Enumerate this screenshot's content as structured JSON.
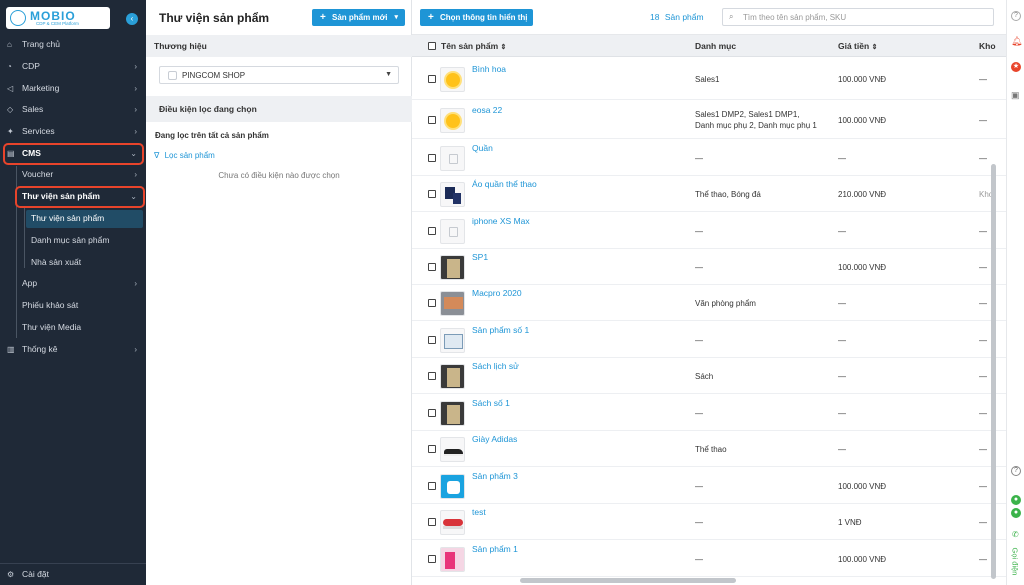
{
  "brand": {
    "name": "MOBIO",
    "tagline": "CDP & CEM Platform",
    "collapse_icon": "chevron-left-icon"
  },
  "sidebar": {
    "items": [
      {
        "label": "Trang chủ",
        "icon": "home-icon",
        "has_chevron": false
      },
      {
        "label": "CDP",
        "icon": "user-icon",
        "has_chevron": true
      },
      {
        "label": "Marketing",
        "icon": "megaphone-icon",
        "has_chevron": true
      },
      {
        "label": "Sales",
        "icon": "tag-icon",
        "has_chevron": true
      },
      {
        "label": "Services",
        "icon": "services-icon",
        "has_chevron": true
      },
      {
        "label": "CMS",
        "icon": "cms-icon",
        "has_chevron": true
      }
    ],
    "cms_children": [
      {
        "label": "Voucher",
        "has_chevron": true
      },
      {
        "label": "Thư viện sản phẩm",
        "has_chevron": true
      }
    ],
    "product_children": [
      {
        "label": "Thư viện sản phẩm"
      },
      {
        "label": "Danh mục sản phẩm"
      },
      {
        "label": "Nhà sản xuất"
      }
    ],
    "more_children": [
      {
        "label": "App",
        "has_chevron": true
      },
      {
        "label": "Phiếu khảo sát",
        "has_chevron": false
      },
      {
        "label": "Thư viện Media",
        "has_chevron": false
      }
    ],
    "stats": {
      "label": "Thống kê",
      "icon": "chart-icon"
    },
    "settings": {
      "label": "Cài đặt",
      "icon": "gear-icon"
    }
  },
  "header": {
    "title": "Thư viện sản phẩm",
    "new_product_label": "Sản phẩm mới",
    "choose_info_label": "Chọn thông tin hiển thị",
    "count_number": "18",
    "count_label": "Sản phẩm",
    "search_placeholder": "Tìm theo tên sản phẩm, SKU"
  },
  "filter_panel": {
    "brand_heading": "Thương hiệu",
    "brand_value": "PINGCOM SHOP",
    "conditions_heading": "Điều kiện lọc đang chọn",
    "filtering_text": "Đang lọc trên tất cả sản phẩm",
    "filter_link": "Lọc sản phẩm",
    "empty_text": "Chưa có điều kiện nào được chọn"
  },
  "table": {
    "columns": [
      "Tên sản phẩm",
      "Danh mục",
      "Giá tiền",
      "Kho"
    ],
    "rows": [
      {
        "name": "Bình hoa",
        "category": "Sales1",
        "price": "100.000 VNĐ",
        "stock": "—",
        "thumb": "sun"
      },
      {
        "name": "eosa 22",
        "category": "Sales1 DMP2, Sales1 DMP1, Danh mục phụ 2, Danh mục phụ 1",
        "price": "100.000 VNĐ",
        "stock": "—",
        "thumb": "sun"
      },
      {
        "name": "Quần",
        "category": "—",
        "price": "—",
        "stock": "—",
        "thumb": "placeholder"
      },
      {
        "name": "Áo quần thể thao",
        "category": "Thể thao, Bóng đá",
        "price": "210.000 VNĐ",
        "stock": "Kho",
        "thumb": "clothes"
      },
      {
        "name": "iphone XS Max",
        "category": "—",
        "price": "—",
        "stock": "—",
        "thumb": "placeholder"
      },
      {
        "name": "SP1",
        "category": "—",
        "price": "100.000 VNĐ",
        "stock": "—",
        "thumb": "book"
      },
      {
        "name": "Macpro 2020",
        "category": "Văn phòng phẩm",
        "price": "—",
        "stock": "—",
        "thumb": "laptop"
      },
      {
        "name": "Sản phẩm số 1",
        "category": "—",
        "price": "—",
        "stock": "—",
        "thumb": "sketch"
      },
      {
        "name": "Sách lịch sử",
        "category": "Sách",
        "price": "—",
        "stock": "—",
        "thumb": "book"
      },
      {
        "name": "Sách số 1",
        "category": "—",
        "price": "—",
        "stock": "—",
        "thumb": "book"
      },
      {
        "name": "Giày Adidas",
        "category": "Thể thao",
        "price": "—",
        "stock": "—",
        "thumb": "shoe"
      },
      {
        "name": "Sản phẩm 3",
        "category": "—",
        "price": "100.000 VNĐ",
        "stock": "—",
        "thumb": "app"
      },
      {
        "name": "test",
        "category": "—",
        "price": "1 VNĐ",
        "stock": "—",
        "thumb": "sneaker"
      },
      {
        "name": "Sản phẩm 1",
        "category": "—",
        "price": "100.000 VNĐ",
        "stock": "—",
        "thumb": "pink"
      }
    ]
  },
  "rail": {
    "call_label": "Gọi điện"
  },
  "colors": {
    "accent": "#1e95d6",
    "sidebar_bg": "#1f2937",
    "highlight": "#e8442b",
    "active_leaf": "#214c66"
  }
}
